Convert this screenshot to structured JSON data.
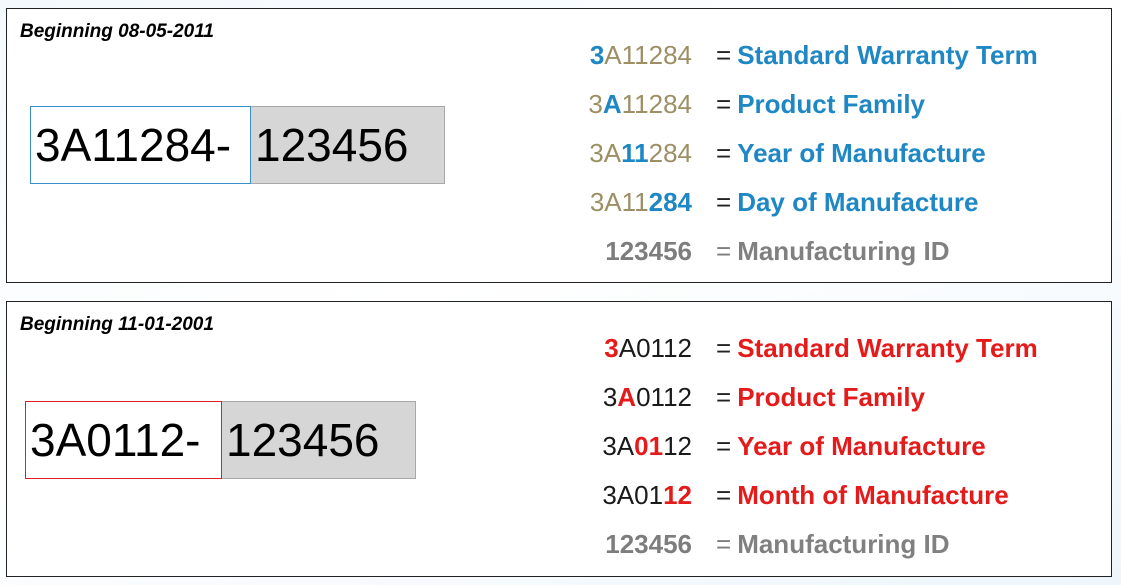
{
  "panel1": {
    "title": "Beginning 08-05-2011",
    "serial_prefix": "3A11284-",
    "serial_suffix": "123456",
    "eq": "=",
    "rows": [
      {
        "c1": "3",
        "c2": "A11284",
        "desc": "Standard Warranty Term"
      },
      {
        "c1": "3",
        "c2": "A",
        "c3": "11284",
        "desc": "Product Family"
      },
      {
        "c1": "3A",
        "c2": "11",
        "c3": "284",
        "desc": "Year of Manufacture"
      },
      {
        "c1": "3A11",
        "c2": "284",
        "desc": "Day of Manufacture"
      },
      {
        "code": "123456",
        "desc": "Manufacturing ID"
      }
    ]
  },
  "panel2": {
    "title": "Beginning 11-01-2001",
    "serial_prefix": "3A0112-",
    "serial_suffix": "123456",
    "eq": "=",
    "rows": [
      {
        "c1": "3",
        "c2": "A0112",
        "desc": "Standard Warranty Term"
      },
      {
        "c1": "3",
        "c2": "A",
        "c3": "0112",
        "desc": "Product Family"
      },
      {
        "c1": "3A",
        "c2": "01",
        "c3": "12",
        "desc": "Year of Manufacture"
      },
      {
        "c1": "3A01",
        "c2": "12",
        "desc": "Month of Manufacture"
      },
      {
        "code": "123456",
        "desc": "Manufacturing ID"
      }
    ]
  },
  "colors": {
    "panel1_highlight": "#1f88c4",
    "panel1_dim": "#9c8f64",
    "panel2_highlight": "#e51b1b",
    "gray": "#7d7d7d"
  }
}
